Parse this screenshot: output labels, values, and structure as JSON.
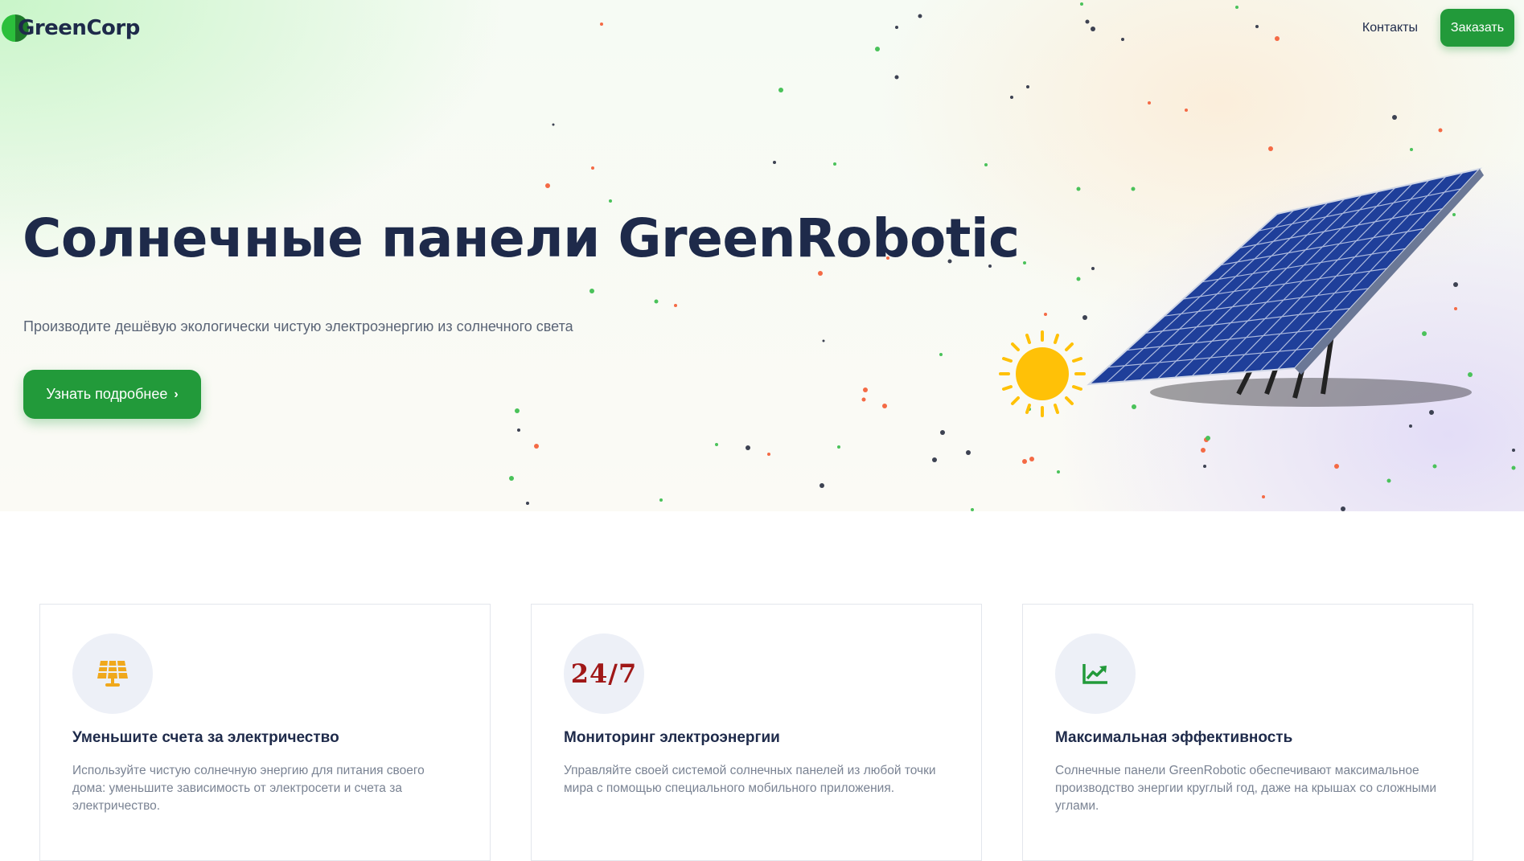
{
  "nav": {
    "logo_text": "GreenCorp",
    "contacts_label": "Контакты",
    "order_label": "Заказать"
  },
  "hero": {
    "title": "Солнечные панели GreenRobotic",
    "subtitle": "Производите дешёвую экологически чистую электроэнергию из солнечного света",
    "cta_label": "Узнать подробнее",
    "cta_icon": "chevron-right-icon"
  },
  "features": [
    {
      "icon": "solar-panel-icon",
      "icon_color": "#f0a81c",
      "title": "Уменьшите счета за электричество",
      "text": "Используйте чистую солнечную энергию для питания своего дома: уменьшите зависимость от электросети и счета за электричество."
    },
    {
      "icon": "24-7-icon",
      "icon_text": "24/7",
      "icon_color": "#a01818",
      "title": "Мониторинг электроэнергии",
      "text": "Управляйте своей системой солнечных панелей из любой точки мира с помощью специального мобильного приложения."
    },
    {
      "icon": "chart-line-icon",
      "icon_color": "#229a3a",
      "title": "Максимальная эффективность",
      "text": "Солнечные панели GreenRobotic обеспечивают максимальное производство энергии круглый год, даже на крышах со сложными углами."
    }
  ],
  "colors": {
    "brand_green": "#229a3a",
    "heading": "#1e2a4a",
    "muted_text": "#7a8393",
    "sun": "#ffc107",
    "panel_blue": "#1f3f9a"
  }
}
